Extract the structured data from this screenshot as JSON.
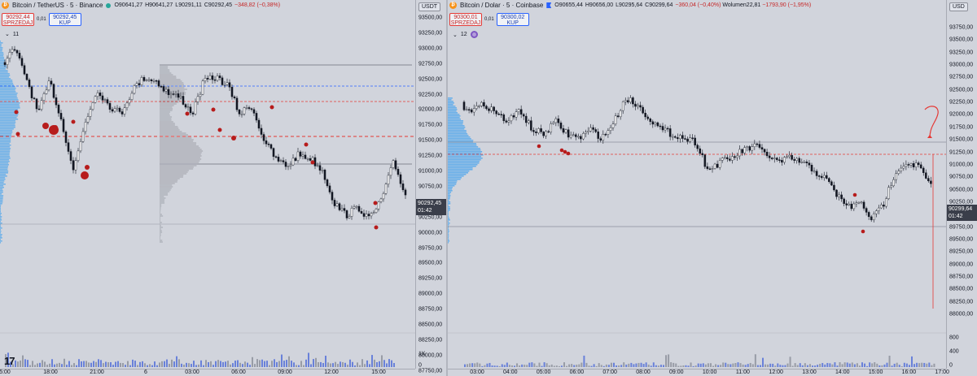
{
  "left": {
    "title": "Bitcoin / TetherUS · 5 · Binance",
    "ohlc": {
      "o": "O90641,27",
      "h": "H90641,27",
      "l": "L90291,11",
      "c": "C90292,45",
      "chg": "−348,82 (−0,38%)"
    },
    "sell": {
      "price": "90292,44",
      "label": "SPRZEDAJ"
    },
    "buy": {
      "price": "90292,45",
      "label": "KUP"
    },
    "spread": "0,01",
    "indicator_count": "11",
    "currency": "USDT",
    "price_labels": [
      "93500,00",
      "93250,00",
      "93000,00",
      "92750,00",
      "92500,00",
      "92250,00",
      "92000,00",
      "91750,00",
      "91500,00",
      "91250,00",
      "91000,00",
      "90750,00",
      "90500,00",
      "90250,00",
      "90000,00",
      "89750,00",
      "89500,00",
      "89250,00",
      "89000,00",
      "88750,00",
      "88500,00",
      "88250,00",
      "88000,00",
      "87750,00"
    ],
    "last_price": "90292,45",
    "countdown": "01:42",
    "volume_label": "1K",
    "volume_zero": "0",
    "time_labels": [
      "5:00",
      "18:00",
      "21:00",
      "6",
      "03:00",
      "06:00",
      "09:00",
      "12:00",
      "15:00"
    ],
    "logo_text": "17"
  },
  "right": {
    "title": "Bitcoin / Dolar · 5 · Coinbase",
    "ohlc": {
      "o": "O90655,44",
      "h": "H90656,00",
      "l": "L90295,64",
      "c": "C90299,64",
      "chg": "−360,04 (−0,40%)",
      "vol": "Wolumen22,81",
      "vol_chg": "−1793,90 (−1,95%)"
    },
    "sell": {
      "price": "90300,01",
      "label": "SPRZEDAJ"
    },
    "buy": {
      "price": "90300,02",
      "label": "KUP"
    },
    "spread": "0,01",
    "indicator_count": "12",
    "currency": "USD",
    "price_labels": [
      "93750,00",
      "93500,00",
      "93250,00",
      "93000,00",
      "92750,00",
      "92500,00",
      "92250,00",
      "92000,00",
      "91750,00",
      "91500,00",
      "91250,00",
      "91000,00",
      "90750,00",
      "90500,00",
      "90250,00",
      "90000,00",
      "89750,00",
      "89500,00",
      "89250,00",
      "89000,00",
      "88750,00",
      "88500,00",
      "88250,00",
      "88000,00"
    ],
    "last_price": "90299,64",
    "countdown": "01:42",
    "volume_labels": [
      "800",
      "400",
      "0"
    ],
    "time_labels": [
      "03:00",
      "04:00",
      "05:00",
      "06:00",
      "07:00",
      "08:00",
      "09:00",
      "10:00",
      "11:00",
      "12:00",
      "13:00",
      "14:00",
      "15:00",
      "16:00",
      "17:00"
    ]
  },
  "colors": {
    "up": "#ffffff",
    "down": "#131722",
    "accent_blue": "#2962ff",
    "red_line": "#e53935",
    "dot": "#b71c1c",
    "profile": "#2196f3"
  }
}
